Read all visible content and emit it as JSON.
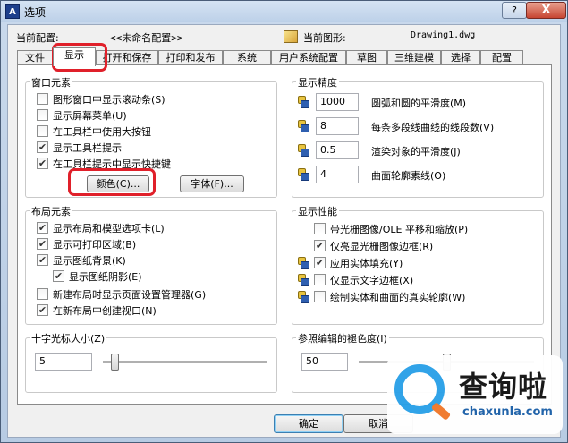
{
  "window": {
    "title": "选项",
    "icon_label": "A",
    "help_label": "?",
    "close_label": "X"
  },
  "header": {
    "current_profile_label": "当前配置:",
    "current_profile_value": "<<未命名配置>>",
    "current_drawing_label": "当前图形:",
    "current_drawing_value": "Drawing1.dwg"
  },
  "tabs": [
    {
      "label": "文件"
    },
    {
      "label": "显示",
      "active": true
    },
    {
      "label": "打开和保存"
    },
    {
      "label": "打印和发布"
    },
    {
      "label": "系统"
    },
    {
      "label": "用户系统配置"
    },
    {
      "label": "草图"
    },
    {
      "label": "三维建模"
    },
    {
      "label": "选择"
    },
    {
      "label": "配置"
    }
  ],
  "window_elements": {
    "title": "窗口元素",
    "items": [
      {
        "label": "图形窗口中显示滚动条(S)",
        "checked": false
      },
      {
        "label": "显示屏幕菜单(U)",
        "checked": false
      },
      {
        "label": "在工具栏中使用大按钮",
        "checked": false
      },
      {
        "label": "显示工具栏提示",
        "checked": true
      },
      {
        "label": "在工具栏提示中显示快捷键",
        "checked": true
      }
    ],
    "color_button": "颜色(C)...",
    "font_button": "字体(F)..."
  },
  "layout_elements": {
    "title": "布局元素",
    "items": [
      {
        "label": "显示布局和模型选项卡(L)",
        "checked": true
      },
      {
        "label": "显示可打印区域(B)",
        "checked": true
      },
      {
        "label": "显示图纸背景(K)",
        "checked": true
      },
      {
        "label": "显示图纸阴影(E)",
        "checked": true
      },
      {
        "label": "新建布局时显示页面设置管理器(G)",
        "checked": false
      },
      {
        "label": "在新布局中创建视口(N)",
        "checked": true
      }
    ]
  },
  "crosshair": {
    "title": "十字光标大小(Z)",
    "value": "5",
    "slider_fraction": 0.05
  },
  "display_resolution": {
    "title": "显示精度",
    "items": [
      {
        "value": "1000",
        "label": "圆弧和圆的平滑度(M)"
      },
      {
        "value": "8",
        "label": "每条多段线曲线的线段数(V)"
      },
      {
        "value": "0.5",
        "label": "渲染对象的平滑度(J)"
      },
      {
        "value": "4",
        "label": "曲面轮廓素线(O)"
      }
    ]
  },
  "display_performance": {
    "title": "显示性能",
    "items": [
      {
        "label": "带光栅图像/OLE 平移和缩放(P)",
        "checked": false
      },
      {
        "label": "仅亮显光栅图像边框(R)",
        "checked": true
      },
      {
        "label": "应用实体填充(Y)",
        "checked": true
      },
      {
        "label": "仅显示文字边框(X)",
        "checked": false
      },
      {
        "label": "绘制实体和曲面的真实轮廓(W)",
        "checked": false
      }
    ]
  },
  "xref_fade": {
    "title": "参照编辑的褪色度(I)",
    "value": "50",
    "slider_fraction": 0.5
  },
  "footer": {
    "ok": "确定",
    "cancel": "取消"
  },
  "watermark": {
    "text": "查询啦",
    "sub": "chaxunla.com"
  },
  "colors": {
    "highlight_ring": "#e0202a",
    "title_bar": "#bcd0e8",
    "close_button": "#c74532"
  }
}
